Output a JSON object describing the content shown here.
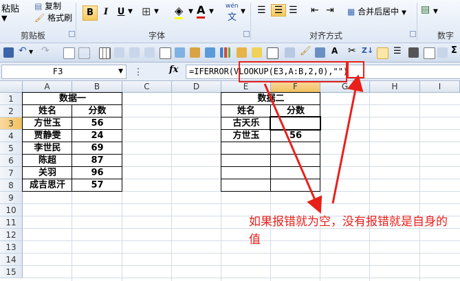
{
  "ribbon": {
    "paste": "粘贴",
    "copy": "复制",
    "format_painter": "格式刷",
    "clipboard_group": "剪贴板",
    "bold": "B",
    "italic": "I",
    "underline": "U",
    "font_group": "字体",
    "wen": "wén",
    "merge_center": "合并后居中",
    "align_group": "对齐方式",
    "number_group": "数字"
  },
  "formula_bar": {
    "name_box": "F3",
    "fx": "fx",
    "formula": "=IFERROR(VLOOKUP(E3,A:B,2,0),\"\")"
  },
  "columns": [
    "A",
    "B",
    "C",
    "D",
    "E",
    "F",
    "G",
    "H",
    "I"
  ],
  "rows": [
    "1",
    "2",
    "3",
    "4",
    "5",
    "6",
    "7",
    "8",
    "9",
    "10",
    "11",
    "12",
    "13",
    "14",
    "15"
  ],
  "table1": {
    "title": "数据一",
    "headers": [
      "姓名",
      "分数"
    ],
    "rows": [
      [
        "方世玉",
        "56"
      ],
      [
        "贾静雯",
        "24"
      ],
      [
        "李世民",
        "69"
      ],
      [
        "陈超",
        "87"
      ],
      [
        "关羽",
        "96"
      ],
      [
        "成吉思汗",
        "57"
      ]
    ]
  },
  "table2": {
    "title": "数据二",
    "headers": [
      "姓名",
      "分数"
    ],
    "rows": [
      [
        "古天乐",
        ""
      ],
      [
        "方世玉",
        "56"
      ],
      [
        "",
        ""
      ],
      [
        "",
        ""
      ],
      [
        "",
        ""
      ],
      [
        "",
        ""
      ]
    ]
  },
  "annotation": {
    "text": "如果报错就为空，没有报错就是自身的值",
    "color": "#e8201a"
  },
  "colors": {
    "accent": "#e8201a",
    "selected_header": "#f1c15f"
  }
}
